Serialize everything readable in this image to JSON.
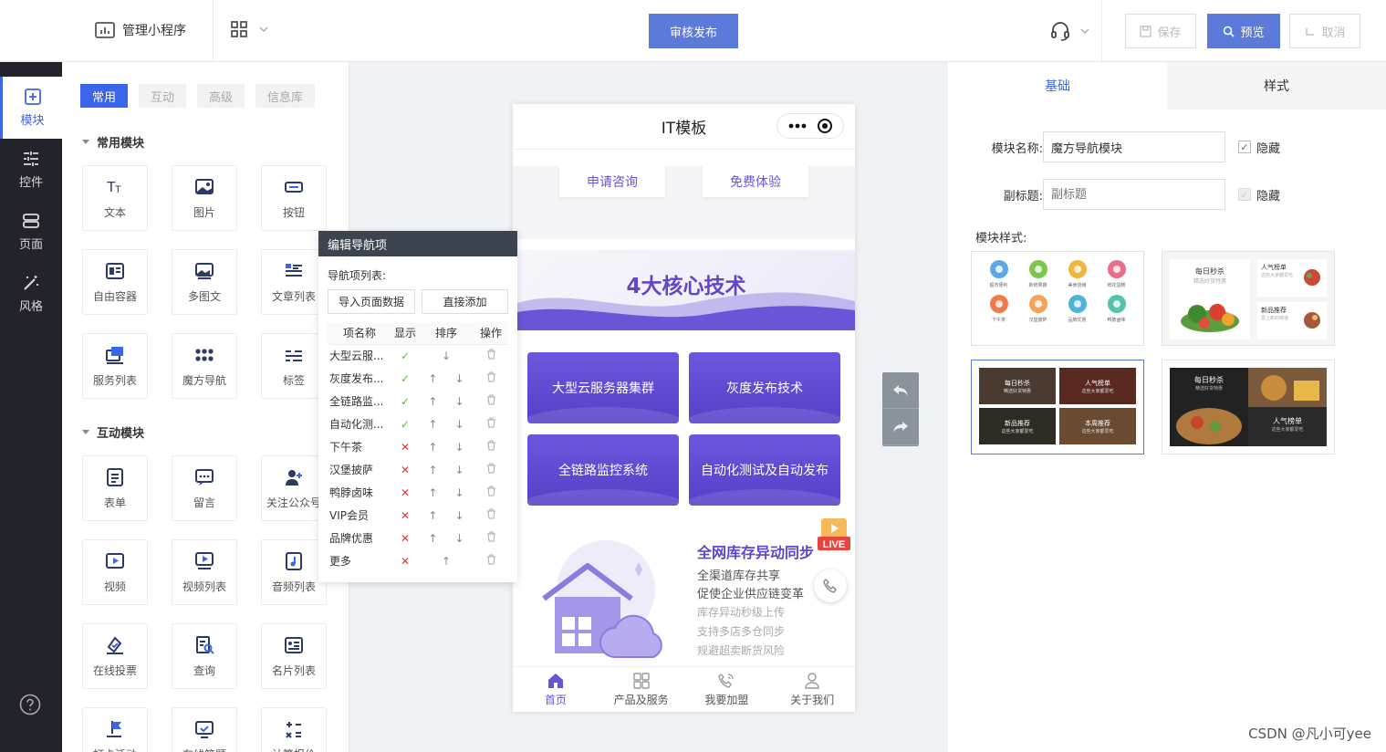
{
  "topbar": {
    "app_title": "管理小程序",
    "publish": "审核发布",
    "save": "保存",
    "preview": "预览",
    "cancel": "取消",
    "accent": "#5b7ad9"
  },
  "leftnav": [
    {
      "label": "模块",
      "icon": "module-icon",
      "active": true
    },
    {
      "label": "控件",
      "icon": "controls-icon"
    },
    {
      "label": "页面",
      "icon": "page-icon"
    },
    {
      "label": "风格",
      "icon": "style-wand-icon"
    }
  ],
  "panel": {
    "tabs": [
      "常用",
      "互动",
      "高级",
      "信息库"
    ],
    "common_title": "常用模块",
    "common": [
      {
        "label": "文本",
        "icon": "text-icon"
      },
      {
        "label": "图片",
        "icon": "image-icon"
      },
      {
        "label": "按钮",
        "icon": "button-icon"
      },
      {
        "label": "自由容器",
        "icon": "container-icon"
      },
      {
        "label": "多图文",
        "icon": "multi-image-icon"
      },
      {
        "label": "文章列表",
        "icon": "article-list-icon"
      },
      {
        "label": "服务列表",
        "icon": "service-list-icon"
      },
      {
        "label": "魔方导航",
        "icon": "cube-nav-icon"
      },
      {
        "label": "标签",
        "icon": "tag-icon"
      }
    ],
    "interactive_title": "互动模块",
    "interactive": [
      {
        "label": "表单",
        "icon": "form-icon"
      },
      {
        "label": "留言",
        "icon": "message-icon"
      },
      {
        "label": "关注公众号",
        "icon": "follow-icon"
      },
      {
        "label": "视频",
        "icon": "video-icon"
      },
      {
        "label": "视频列表",
        "icon": "video-list-icon"
      },
      {
        "label": "音频列表",
        "icon": "audio-list-icon"
      },
      {
        "label": "在线投票",
        "icon": "vote-icon"
      },
      {
        "label": "查询",
        "icon": "query-icon"
      },
      {
        "label": "名片列表",
        "icon": "card-list-icon"
      },
      {
        "label": "打卡活动",
        "icon": "checkin-icon"
      },
      {
        "label": "在线答题",
        "icon": "quiz-icon"
      },
      {
        "label": "计算报价",
        "icon": "calc-icon"
      }
    ]
  },
  "phone": {
    "title": "IT模板",
    "btn1": "申请咨询",
    "btn2": "免费体验",
    "banner": "4大核心技术",
    "techs": [
      "大型云服务器集群",
      "灰度发布技术",
      "全链路监控系统",
      "自动化测试及自动发布"
    ],
    "inventory": {
      "title": "全网库存异动同步",
      "l1": "全渠道库存共享",
      "l2": "促使企业供应链变革",
      "s1": "库存异动秒级上传",
      "s2": "支持多店多仓同步",
      "s3": "规避超卖断货风险"
    },
    "live": "LIVE",
    "nav": [
      "首页",
      "产品及服务",
      "我要加盟",
      "关于我们"
    ]
  },
  "editNav": {
    "title": "编辑导航项",
    "list_label": "导航项列表:",
    "import_btn": "导入页面数据",
    "add_btn": "直接添加",
    "cols": [
      "项名称",
      "显示",
      "排序",
      "操作"
    ],
    "rows": [
      {
        "name": "大型云服...",
        "show": true,
        "up": false,
        "down": true
      },
      {
        "name": "灰度发布...",
        "show": true,
        "up": true,
        "down": true
      },
      {
        "name": "全链路监...",
        "show": true,
        "up": true,
        "down": true
      },
      {
        "name": "自动化测...",
        "show": true,
        "up": true,
        "down": true
      },
      {
        "name": "下午茶",
        "show": false,
        "up": true,
        "down": true
      },
      {
        "name": "汉堡披萨",
        "show": false,
        "up": true,
        "down": true
      },
      {
        "name": "鸭脖卤味",
        "show": false,
        "up": true,
        "down": true
      },
      {
        "name": "VIP会员",
        "show": false,
        "up": true,
        "down": true
      },
      {
        "name": "品牌优惠",
        "show": false,
        "up": true,
        "down": true
      },
      {
        "name": "更多",
        "show": false,
        "up": true,
        "down": false
      }
    ]
  },
  "right": {
    "tabs": [
      "基础",
      "样式"
    ],
    "name_label": "模块名称:",
    "name_value": "魔方导航模块",
    "sub_label": "副标题:",
    "sub_placeholder": "副标题",
    "hide": "隐藏",
    "style_label": "模块样式:",
    "style1_items": [
      "超市便利",
      "新鲜果蔬",
      "美食烧烤",
      "鲜花蛋糕",
      "下午茶",
      "汉堡披萨",
      "品牌优惠",
      "鸭脖卤味"
    ],
    "style2": {
      "a": "每日秒杀",
      "a_sub": "精选好货特惠",
      "b": "人气榜单",
      "b_sub": "这些大家都爱吃",
      "c": "新品推荐",
      "c_sub": "爱上新的味道"
    },
    "style3": {
      "a": "每日秒杀",
      "b": "人气榜单",
      "c": "新品推荐",
      "d": "本周推荐",
      "a_sub": "精选好货特惠",
      "b_sub": "这些大家都爱吃",
      "c_sub": "这些大家都爱吃",
      "d_sub": "这些大家都爱吃"
    },
    "style4": {
      "a": "每日秒杀",
      "a_sub": "精选好货特惠",
      "b": "人气榜单",
      "b_sub": "这些大家都爱吃"
    }
  },
  "watermark": "CSDN @凡小可yee"
}
